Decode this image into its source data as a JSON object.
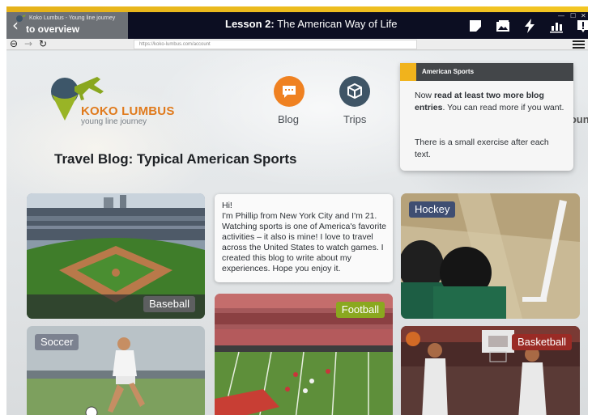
{
  "titlebar": {
    "back_small": "Koko Lumbus - Young line journey",
    "back_label": "to overview",
    "lesson_prefix": "Lesson 2:",
    "lesson_name": " The American Way of Life",
    "icons": [
      "note-icon",
      "gallery-icon",
      "lightning-icon",
      "chart-icon",
      "info-icon"
    ],
    "window_controls": [
      "minimize-icon",
      "maximize-icon",
      "close-icon"
    ]
  },
  "browser": {
    "url": "https://koko-lumbus.com/account",
    "nav_icons": [
      "back-arrow-icon",
      "forward-arrow-icon",
      "reload-icon",
      "menu-icon"
    ]
  },
  "brand": {
    "name": "KOKO LUMBUS",
    "tagline": "young line journey"
  },
  "nav": {
    "blog": "Blog",
    "trips": "Trips",
    "account": "Account"
  },
  "tooltip": {
    "title": "American Sports",
    "line1_pre": "Now ",
    "line1_bold": "read at least two more blog entries",
    "line1_post": ". You can read more if you want.",
    "line2": "There is a small exercise after each text."
  },
  "page": {
    "title": "Travel Blog: Typical American Sports"
  },
  "intro_text": "Hi!\nI'm Phillip from New York City and I'm 21. Watching sports is one of America's favorite activities – it also is mine! I love to travel across the United States to watch games. I created this blog to write about my experiences. Hope you enjoy it.",
  "cards": {
    "baseball": "Baseball",
    "hockey": "Hockey",
    "football": "Football",
    "soccer": "Soccer",
    "basketball": "Basketball"
  },
  "colors": {
    "accent": "#f1b31c",
    "brand_orange": "#e07a1c",
    "blog_button": "#ef8121",
    "trips_button": "#3f5566",
    "football_label": "#8aa81f",
    "hockey_label": "#3f4e72",
    "soccer_label": "#7c8290",
    "basketball_label": "#9a2b25",
    "baseball_label": "#5d5f60"
  }
}
